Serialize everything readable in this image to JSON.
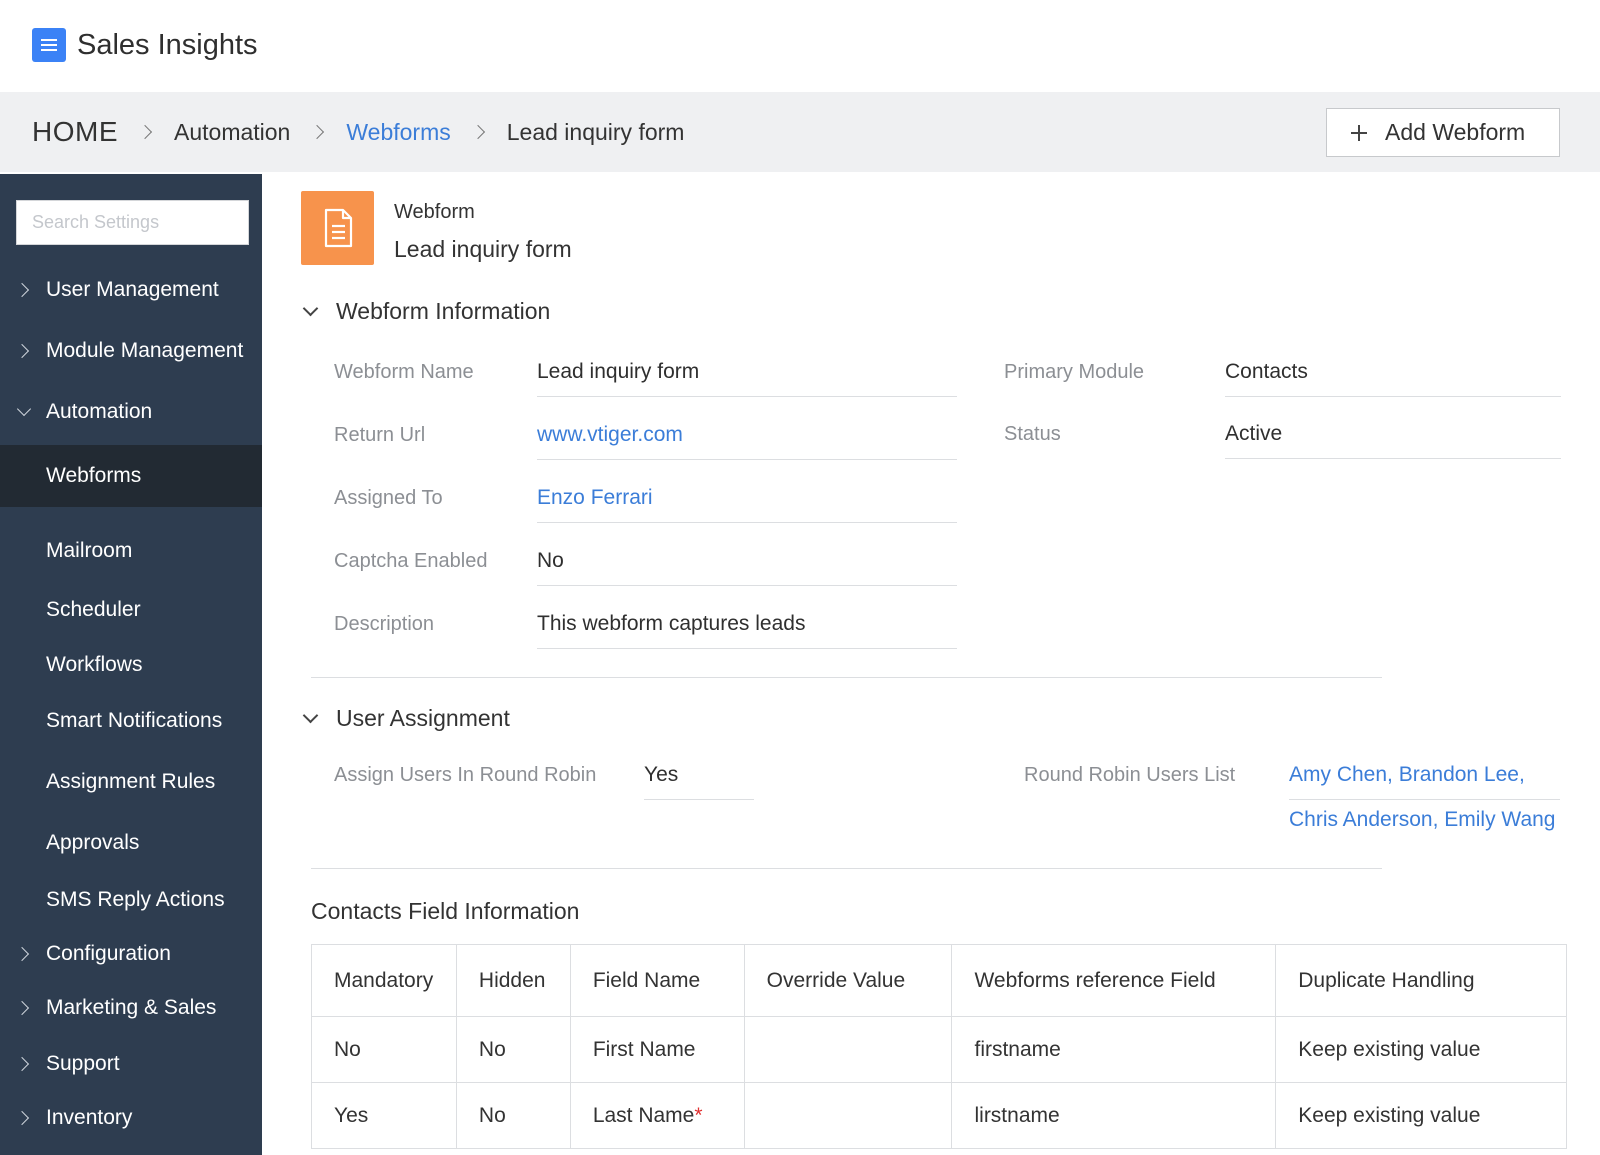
{
  "app": {
    "title": "Sales Insights",
    "logo_icon": "list-document-icon",
    "accent": "#3b82f6"
  },
  "breadcrumb": {
    "items": [
      "HOME",
      "Automation",
      "Webforms",
      "Lead inquiry form"
    ],
    "link_color": "#3b7dd8"
  },
  "header": {
    "add_button": "Add Webform"
  },
  "sidebar": {
    "search_placeholder": "Search Settings",
    "items": [
      {
        "label": "User Management",
        "icon": "chevron-right-icon"
      },
      {
        "label": "Module Management",
        "icon": "chevron-right-icon"
      },
      {
        "label": "Automation",
        "icon": "chevron-down-icon"
      },
      {
        "label": "Webforms",
        "active": true
      },
      {
        "label": "Mailroom"
      },
      {
        "label": "Scheduler"
      },
      {
        "label": "Workflows"
      },
      {
        "label": "Smart Notifications"
      },
      {
        "label": "Assignment Rules"
      },
      {
        "label": "Approvals"
      },
      {
        "label": "SMS Reply Actions"
      },
      {
        "label": "Configuration",
        "icon": "chevron-right-icon"
      },
      {
        "label": "Marketing & Sales",
        "icon": "chevron-right-icon"
      },
      {
        "label": "Support",
        "icon": "chevron-right-icon"
      },
      {
        "label": "Inventory",
        "icon": "chevron-right-icon"
      }
    ],
    "background": "#2e3d50",
    "active_background": "#222a33"
  },
  "record": {
    "kicker": "Webform",
    "title": "Lead inquiry form",
    "icon": "document-icon",
    "icon_color": "#f7934c"
  },
  "webform_info": {
    "heading": "Webform Information",
    "fields": {
      "name": {
        "label": "Webform Name",
        "value": "Lead inquiry form"
      },
      "return_url": {
        "label": "Return Url",
        "value": "www.vtiger.com"
      },
      "assigned_to": {
        "label": "Assigned To",
        "value": "Enzo Ferrari"
      },
      "captcha": {
        "label": "Captcha Enabled",
        "value": "No"
      },
      "description": {
        "label": "Description",
        "value": "This webform captures leads"
      },
      "primary_module": {
        "label": "Primary Module",
        "value": "Contacts"
      },
      "status": {
        "label": "Status",
        "value": "Active"
      }
    }
  },
  "user_assignment": {
    "heading": "User Assignment",
    "round_robin": {
      "label": "Assign Users In Round Robin",
      "value": "Yes"
    },
    "users_list": {
      "label": "Round Robin Users List",
      "line1": "Amy Chen, Brandon Lee,",
      "line2": "Chris Anderson, Emily Wang"
    }
  },
  "contacts_fields": {
    "heading": "Contacts Field Information",
    "columns": [
      "Mandatory",
      "Hidden",
      "Field Name",
      "Override Value",
      "Webforms reference Field",
      "Duplicate Handling"
    ],
    "rows": [
      {
        "mandatory": "No",
        "hidden": "No",
        "field_name": "First Name",
        "override": "",
        "reference": "firstname",
        "duplicate": "Keep existing value"
      },
      {
        "mandatory": "Yes",
        "hidden": "No",
        "field_name": "Last Name",
        "required_mark": "*",
        "override": "",
        "reference": "lirstname",
        "duplicate": "Keep existing value"
      }
    ]
  }
}
